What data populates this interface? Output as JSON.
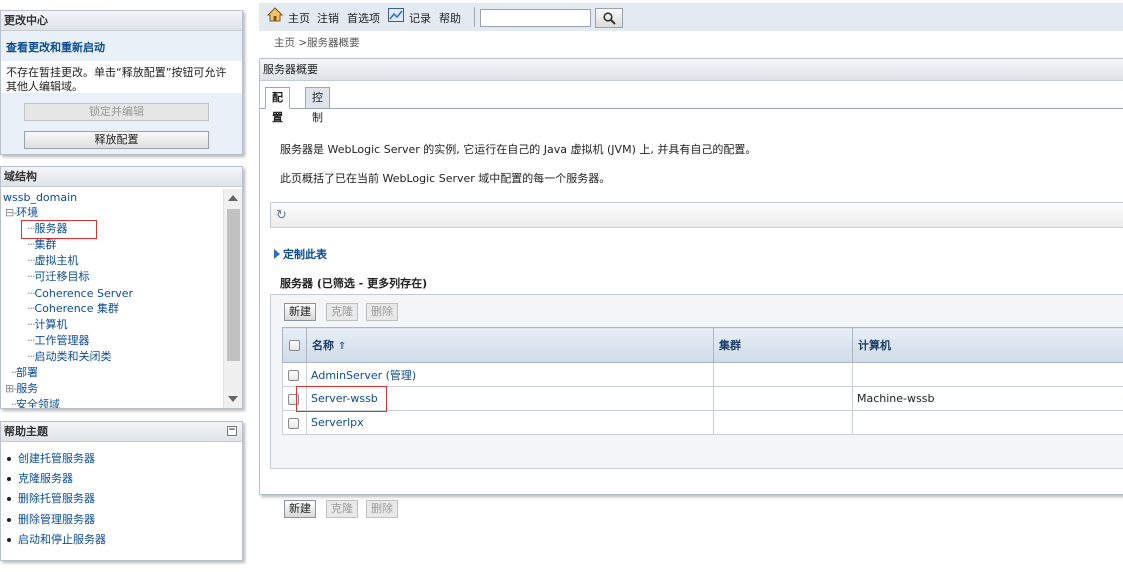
{
  "change_center": {
    "title": "更改中心",
    "link": "查看更改和重新启动",
    "desc": "不存在暂挂更改。单击“释放配置”按钮可允许其他人编辑域。",
    "lock_button": "锁定并编辑",
    "release_button": "释放配置"
  },
  "domain_structure": {
    "title": "域结构",
    "root": "wssb_domain",
    "items": [
      {
        "prefix": "⊟-",
        "label": "环境"
      },
      {
        "prefix": "···",
        "label": "服务器"
      },
      {
        "prefix": "···",
        "label": "集群"
      },
      {
        "prefix": "···",
        "label": "虚拟主机"
      },
      {
        "prefix": "···",
        "label": "可迁移目标"
      },
      {
        "prefix": "···",
        "label": "Coherence Server"
      },
      {
        "prefix": "···",
        "label": "Coherence 集群"
      },
      {
        "prefix": "···",
        "label": "计算机"
      },
      {
        "prefix": "···",
        "label": "工作管理器"
      },
      {
        "prefix": "···",
        "label": "启动类和关闭类"
      },
      {
        "prefix": "··",
        "label": "部署"
      },
      {
        "prefix": "⊞-",
        "label": "服务"
      },
      {
        "prefix": "··",
        "label": "安全领域"
      }
    ]
  },
  "help_topics": {
    "title": "帮助主题",
    "collapse": "−",
    "items": [
      "创建托管服务器",
      "克隆服务器",
      "删除托管服务器",
      "删除管理服务器",
      "启动和停止服务器"
    ]
  },
  "toolbar": {
    "home": "主页",
    "logout": "注销",
    "preferences": "首选项",
    "record": "记录",
    "help": "帮助",
    "search_value": ""
  },
  "breadcrumb": "主页 >服务器概要",
  "main": {
    "title": "服务器概要",
    "tabs": [
      "配置",
      "控制"
    ],
    "desc1": "服务器是 WebLogic Server 的实例, 它运行在自己的 Java 虚拟机 (JVM) 上, 并具有自己的配置。",
    "desc2": "此页概括了已在当前 WebLogic Server 域中配置的每一个服务器。",
    "refresh_icon": "↻",
    "customize": "定制此表",
    "table_title": "服务器 (已筛选 - 更多列存在)",
    "buttons": {
      "new": "新建",
      "clone": "克隆",
      "delete": "删除"
    },
    "columns": {
      "name": "名称",
      "sort": "⇑",
      "cluster": "集群",
      "machine": "计算机"
    },
    "rows": [
      {
        "name": "AdminServer (管理)",
        "cluster": "",
        "machine": ""
      },
      {
        "name": "Server-wssb",
        "cluster": "",
        "machine": "Machine-wssb"
      },
      {
        "name": "Serverlpx",
        "cluster": "",
        "machine": ""
      }
    ]
  }
}
